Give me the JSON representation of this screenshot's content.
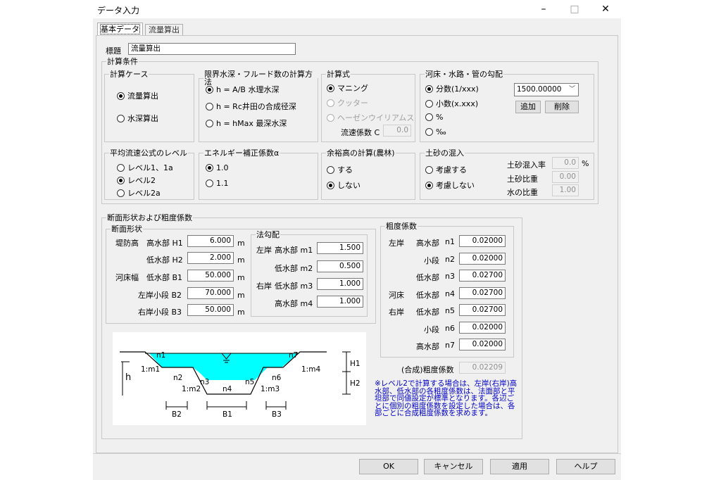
{
  "window": {
    "title": "データ入力",
    "minimize": "–",
    "maximize": "□",
    "close": "✕"
  },
  "tabs": [
    {
      "label": "基本データ",
      "active": true
    },
    {
      "label": "流量算出",
      "active": false
    }
  ],
  "title_field": {
    "label": "標題",
    "value": "流量算出"
  },
  "calc_conditions": {
    "label": "計算条件",
    "case": {
      "label": "計算ケース",
      "options": [
        "流量算出",
        "水深算出"
      ],
      "selected": 0
    },
    "critical": {
      "label": "限界水深・フルード数の計算方法",
      "options": [
        "h = A/B 水理水深",
        "h = Rc井田の合成径深",
        "h = hMax 最深水深"
      ],
      "selected": 0
    },
    "formula": {
      "label": "計算式",
      "options": [
        "マニング",
        "クッター",
        "ヘーゼンウイリアムス"
      ],
      "selected": 0,
      "disabled": [
        1,
        2
      ],
      "coef_label": "流速係数 C",
      "coef_value": "0.0"
    },
    "slope": {
      "label": "河床・水路・管の勾配",
      "options": [
        "分数(1/xxx)",
        "小数(x.xxx)",
        "%",
        "‰"
      ],
      "selected": 0,
      "combo_value": "1500.00000",
      "add_label": "追加",
      "delete_label": "削除"
    },
    "level": {
      "label": "平均流速公式のレベル",
      "options": [
        "レベル1、1a",
        "レベル2",
        "レベル2a"
      ],
      "selected": 1
    },
    "energy": {
      "label": "エネルギー補正係数α",
      "options": [
        "1.0",
        "1.1"
      ],
      "selected": 0
    },
    "freeboard": {
      "label": "余裕高の計算(農林)",
      "options": [
        "する",
        "しない"
      ],
      "selected": 1
    },
    "sediment": {
      "label": "土砂の混入",
      "options": [
        "考慮する",
        "考慮しない"
      ],
      "selected": 1,
      "fields": [
        {
          "label": "土砂混入率",
          "value": "0.0",
          "unit": "%"
        },
        {
          "label": "土砂比重",
          "value": "0.00",
          "unit": ""
        },
        {
          "label": "水の比重",
          "value": "1.00",
          "unit": ""
        }
      ]
    }
  },
  "section": {
    "label": "断面形状および粗度係数",
    "shape": {
      "label": "断面形状",
      "rows": [
        {
          "group": "堤防高",
          "label": "高水部 H1",
          "value": "6.000",
          "unit": "m"
        },
        {
          "group": "",
          "label": "低水部 H2",
          "value": "2.000",
          "unit": "m"
        },
        {
          "group": "河床幅",
          "label": "低水部 B1",
          "value": "50.000",
          "unit": "m"
        },
        {
          "group": "",
          "label": "左岸小段 B2",
          "value": "70.000",
          "unit": "m"
        },
        {
          "group": "",
          "label": "右岸小段 B3",
          "value": "50.000",
          "unit": "m"
        }
      ]
    },
    "slope_grade": {
      "label": "法勾配",
      "rows": [
        {
          "group": "左岸",
          "label": "高水部 m1",
          "value": "1.500"
        },
        {
          "group": "",
          "label": "低水部 m2",
          "value": "0.500"
        },
        {
          "group": "右岸",
          "label": "低水部 m3",
          "value": "1.000"
        },
        {
          "group": "",
          "label": "高水部 m4",
          "value": "1.000"
        }
      ]
    },
    "roughness": {
      "label": "粗度係数",
      "rows": [
        {
          "group": "左岸",
          "label": "高水部",
          "code": "n1",
          "value": "0.02000"
        },
        {
          "group": "",
          "label": "小段",
          "code": "n2",
          "value": "0.02000"
        },
        {
          "group": "",
          "label": "低水部",
          "code": "n3",
          "value": "0.02700"
        },
        {
          "group": "河床",
          "label": "低水部",
          "code": "n4",
          "value": "0.02700"
        },
        {
          "group": "右岸",
          "label": "低水部",
          "code": "n5",
          "value": "0.02700"
        },
        {
          "group": "",
          "label": "小段",
          "code": "n6",
          "value": "0.02000"
        },
        {
          "group": "",
          "label": "高水部",
          "code": "n7",
          "value": "0.02000"
        }
      ],
      "composite_label": "(合成)粗度係数",
      "composite_value": "0.02209"
    },
    "diagram_labels": {
      "n1": "n1",
      "n2": "n2",
      "n3": "n3",
      "n4": "n4",
      "n5": "n5",
      "n6": "n6",
      "n7": "n7",
      "m1": "1:m1",
      "m2": "1:m2",
      "m3": "1:m3",
      "m4": "1:m4",
      "h": "h",
      "H1": "H1",
      "H2": "H2",
      "B1": "B1",
      "B2": "B2",
      "B3": "B3"
    },
    "note": "※レベル2で計算する場合は、左岸(右岸)高水部、低水部の各粗度係数は、法面部と平坦部で同値設定が標準となります。各辺ごとに個別の粗度係数を設定した場合は、各部ごとに合成粗度係数を求めます。"
  },
  "buttons": {
    "ok": "OK",
    "cancel": "キャンセル",
    "apply": "適用",
    "help": "ヘルプ"
  },
  "colors": {
    "water": "#00ffff",
    "note_text": "#0000c8"
  }
}
